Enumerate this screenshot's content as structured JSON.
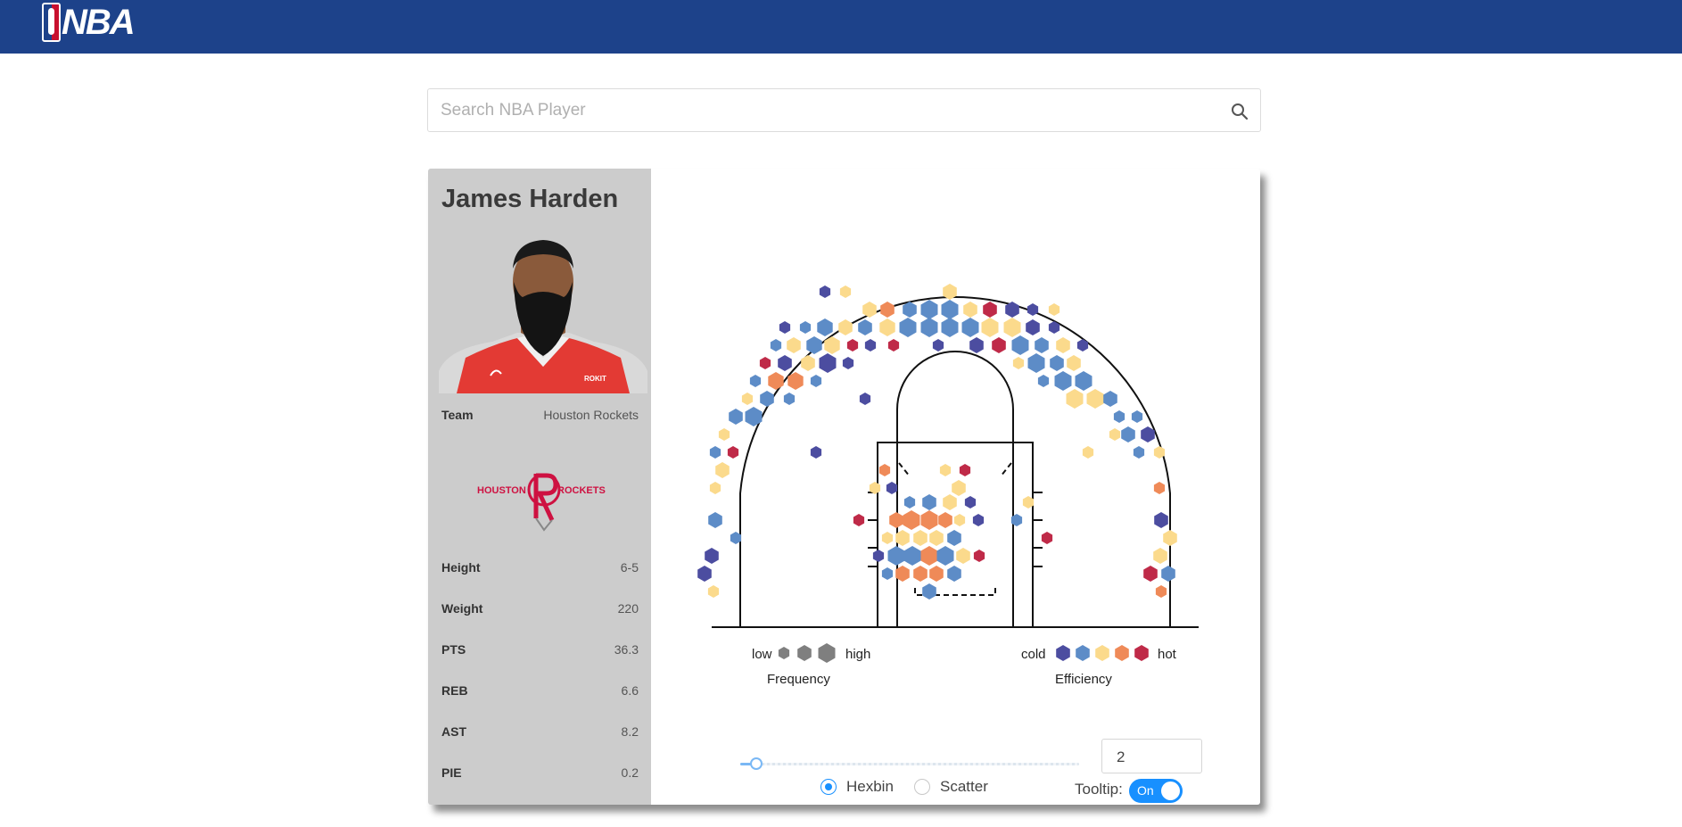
{
  "header": {
    "logo_text": "NBA"
  },
  "search": {
    "placeholder": "Search NBA Player"
  },
  "player": {
    "name": "James Harden",
    "team_label": "Team",
    "team": "Houston Rockets",
    "team_logo_text_left": "HOUSTON",
    "team_logo_text_right": "ROCKETS",
    "jersey_text": "ROKIT",
    "stats": [
      {
        "label": "Height",
        "value": "6-5"
      },
      {
        "label": "Weight",
        "value": "220"
      },
      {
        "label": "PTS",
        "value": "36.3"
      },
      {
        "label": "REB",
        "value": "6.6"
      },
      {
        "label": "AST",
        "value": "8.2"
      },
      {
        "label": "PIE",
        "value": "0.2"
      }
    ]
  },
  "legend": {
    "frequency": {
      "low": "low",
      "high": "high",
      "title": "Frequency"
    },
    "efficiency": {
      "cold": "cold",
      "hot": "hot",
      "title": "Efficiency"
    }
  },
  "controls": {
    "slider_value": 2,
    "number_value": "2",
    "hexbin_label": "Hexbin",
    "scatter_label": "Scatter",
    "selected_mode": "Hexbin",
    "tooltip_label": "Tooltip:",
    "tooltip_state": "On"
  },
  "colors": {
    "nav": "#1d428a",
    "sidebar": "#cccccc",
    "eff": [
      "#4c4da0",
      "#5d8cc7",
      "#fbda8c",
      "#ef8a58",
      "#bf2a48"
    ],
    "frequency_gray": "#7f7f7f",
    "accent": "#1890ff"
  }
}
